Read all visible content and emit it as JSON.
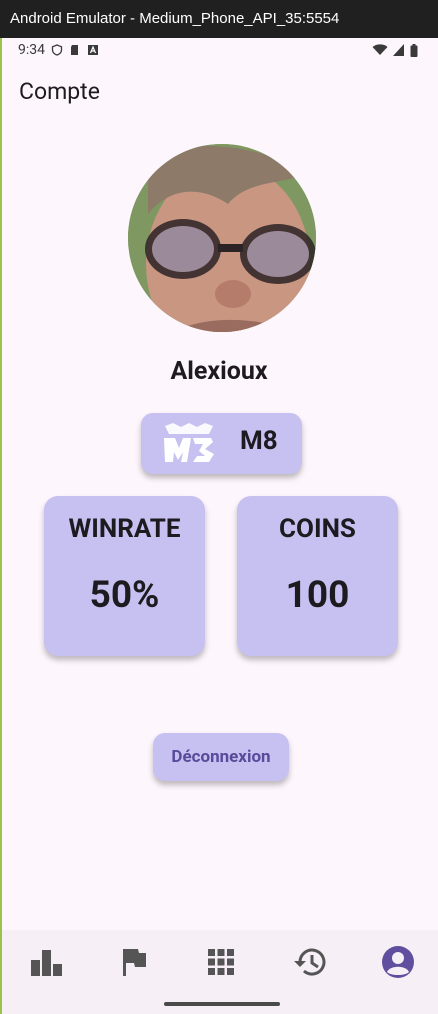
{
  "window": {
    "title": "Android Emulator - Medium_Phone_API_35:5554"
  },
  "status_bar": {
    "time": "9:34"
  },
  "header": {
    "title": "Compte"
  },
  "profile": {
    "username": "Alexioux",
    "rank": "M8"
  },
  "stats": {
    "winrate": {
      "label": "WINRATE",
      "value": "50%"
    },
    "coins": {
      "label": "COINS",
      "value": "100"
    }
  },
  "actions": {
    "logout_label": "Déconnexion"
  },
  "bottom_nav": {
    "items": [
      {
        "icon": "bar-chart-icon"
      },
      {
        "icon": "flag-icon"
      },
      {
        "icon": "grid-icon"
      },
      {
        "icon": "history-icon"
      },
      {
        "icon": "account-circle-icon",
        "active": true
      }
    ]
  },
  "colors": {
    "accent": "#5a4a9a",
    "card": "#c6c1f0",
    "background": "#fdf6fc"
  }
}
